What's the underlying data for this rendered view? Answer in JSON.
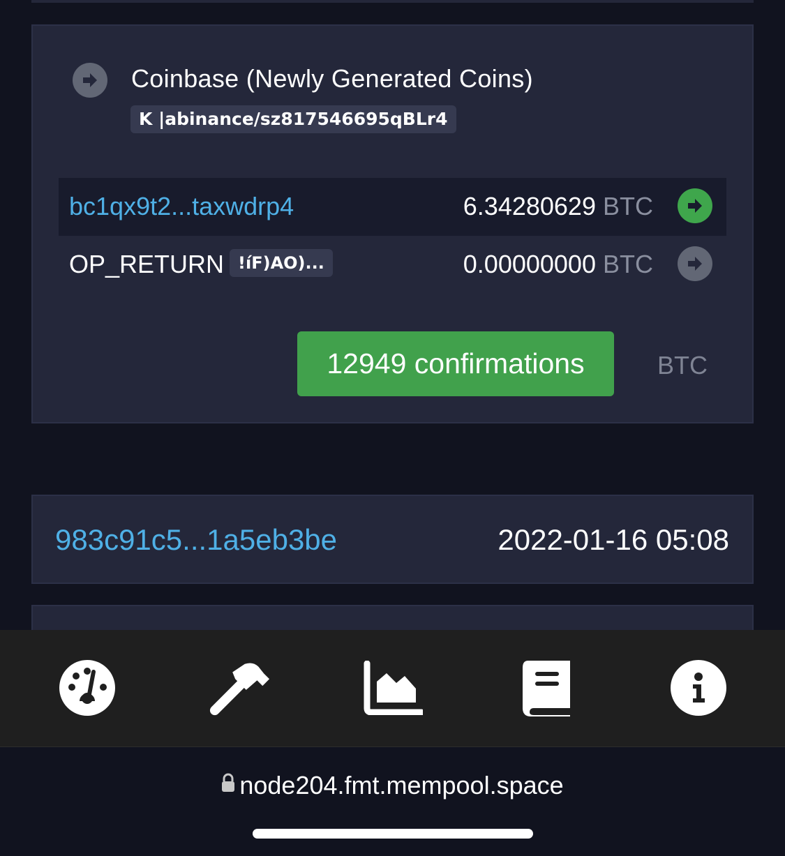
{
  "transaction": {
    "input": {
      "label": "Coinbase (Newly Generated Coins)",
      "script_badge": "K |abinance/sz817546695qBLr4"
    },
    "outputs": [
      {
        "address": "bc1qx9t2...taxwdrp4",
        "amount": "6.34280629",
        "unit": "BTC",
        "status": "spent",
        "arrow_color": "#3fa64c"
      },
      {
        "address": "OP_RETURN",
        "data_badge": "!íF)AO)...",
        "amount": "0.00000000",
        "unit": "BTC",
        "status": "unspendable",
        "arrow_color": "#626775"
      }
    ],
    "confirmations_label": "12949 confirmations",
    "total_unit": "BTC"
  },
  "next_transaction": {
    "txid": "983c91c5...1a5eb3be",
    "timestamp": "2022-01-16 05:08"
  },
  "bottom_nav": [
    {
      "name": "dashboard",
      "icon": "gauge-icon"
    },
    {
      "name": "mining",
      "icon": "hammer-icon"
    },
    {
      "name": "graphs",
      "icon": "area-chart-icon"
    },
    {
      "name": "docs",
      "icon": "book-icon"
    },
    {
      "name": "about",
      "icon": "info-icon"
    }
  ],
  "browser": {
    "url": "node204.fmt.mempool.space"
  },
  "colors": {
    "accent_link": "#4fb0e6",
    "confirm_green": "#41a14c",
    "card_bg": "#24273a",
    "page_bg": "#11131f"
  }
}
